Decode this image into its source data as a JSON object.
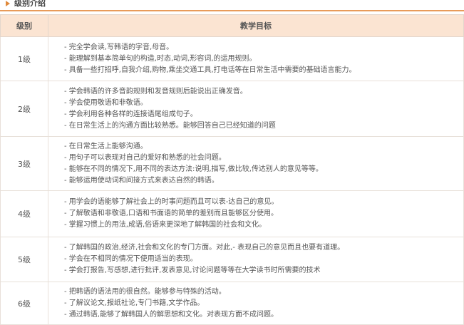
{
  "section": {
    "title": "级别介绍"
  },
  "table": {
    "headers": {
      "level": "级别",
      "goals": "教学目标"
    },
    "rows": [
      {
        "level": "1级",
        "goals": [
          "- 完全学会读,写韩语的字音,母音。",
          "- 能理解到基本简单句的构造,时态,动词,形容词,的运用规则。",
          "- 具备一些打招呼,自我介绍,购物,乘坐交通工具,打电话等在日常生活中需要的基础语言能力。"
        ]
      },
      {
        "level": "2级",
        "goals": [
          "- 学会韩语的许多音韵规则和发音规则后能说出正确发音。",
          "- 学会使用敬语和非敬语。",
          "- 学会利用各种各样的连接语尾组成句子。",
          "- 在日常生活上的沟通方面比较熟悉。能够回答自己已经知道的问题"
        ]
      },
      {
        "level": "3级",
        "goals": [
          "- 在日常生活上能够沟通。",
          "- 用句子可以表现对自己的爱好和熟悉的社会问题。",
          "- 能够在不同的情况下,用不同的表达方法:说明,描写,做比较,传达别人的意见等等。",
          "- 能够运用使动词和间接方式来表达自然的韩语。"
        ]
      },
      {
        "level": "4级",
        "goals": [
          "- 用学会的语能够了解社会上的时事问题而且可以表-达自己的意见。",
          "- 了解敬语和非敬语,口语和书面语的简单的差别而且能够区分使用。",
          "- 掌握习惯上的用法,成语,俗语来更深地了解韩国的社会和文化。"
        ]
      },
      {
        "level": "5级",
        "goals": [
          "- 了解韩国的政治,经济,社会和文化的专门方面。对此,- 表现自己的意见而且也要有道理。",
          "- 学会在不相同的情况下使用适当的表现。",
          "- 学会打报告,写感想,进行批评,发表意见,讨论问题等等在大学读书时所需要的技术"
        ]
      },
      {
        "level": "6级",
        "goals": [
          "- 把韩语的语法用的很自然。能够参与特殊的活动。",
          "- 了解议论文,报纸社论,专门书籍,文学作品。",
          "- 通过韩语,能够了解韩国人的解思想和文化。对表现方面不成问题。"
        ]
      }
    ]
  }
}
